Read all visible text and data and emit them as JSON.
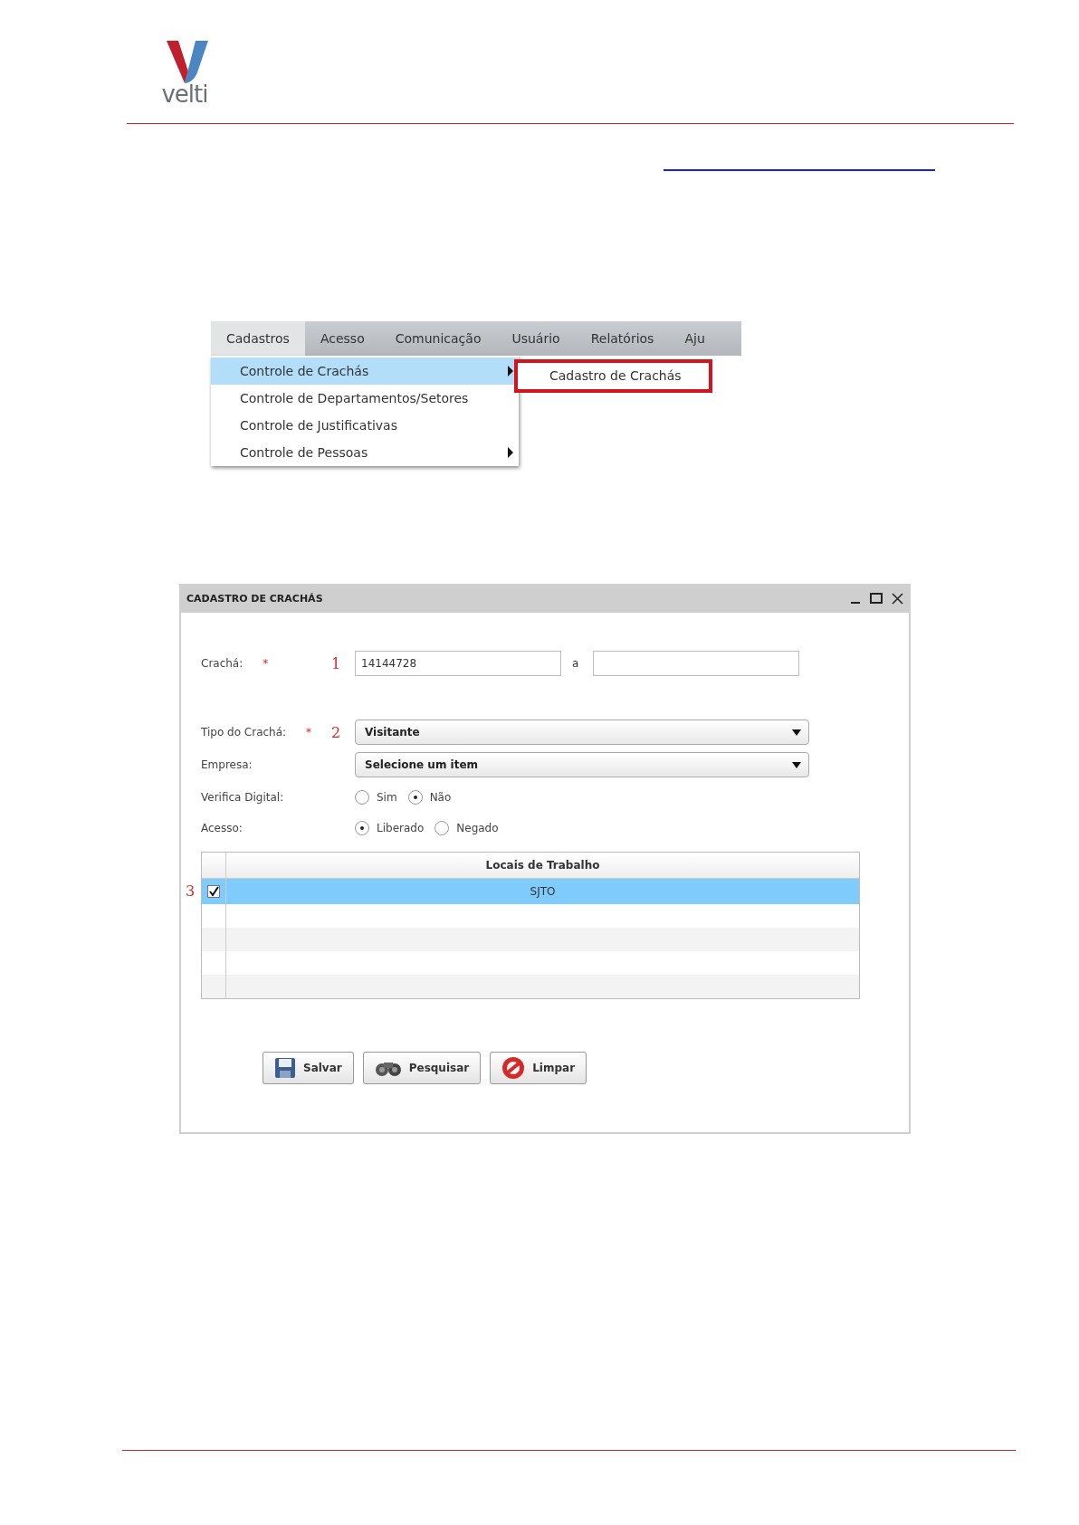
{
  "header": {
    "logo_text": "velti"
  },
  "menu_screenshot": {
    "menubar": [
      {
        "label": "Cadastros",
        "selected": true
      },
      {
        "label": "Acesso",
        "selected": false
      },
      {
        "label": "Comunicação",
        "selected": false
      },
      {
        "label": "Usuário",
        "selected": false
      },
      {
        "label": "Relatórios",
        "selected": false
      },
      {
        "label": "Aju",
        "selected": false
      }
    ],
    "dropdown": [
      {
        "label": "Controle de Crachás",
        "selected": true,
        "has_submenu": true
      },
      {
        "label": "Controle de Departamentos/Setores",
        "selected": false,
        "has_submenu": false
      },
      {
        "label": "Controle de Justificativas",
        "selected": false,
        "has_submenu": false
      },
      {
        "label": "Controle de Pessoas",
        "selected": false,
        "has_submenu": true
      }
    ],
    "submenu": [
      {
        "label": "Cadastro de Crachás",
        "highlighted": true
      }
    ]
  },
  "dialog": {
    "title": "CADASTRO DE CRACHÁS",
    "badge_field": {
      "label": "Crachá:",
      "required_mark": "*",
      "step": "1",
      "value": "14144728",
      "separator": "a"
    },
    "badge_type": {
      "label": "Tipo do Crachá:",
      "required_mark": "*",
      "step": "2",
      "value": "Visitante"
    },
    "company": {
      "label": "Empresa:",
      "value": "Selecione um item"
    },
    "radio_groups": [
      {
        "label": "Verifica Digital:",
        "options": [
          {
            "label": "Sim",
            "selected": false
          },
          {
            "label": "Não",
            "selected": true
          }
        ]
      },
      {
        "label": "Acesso:",
        "options": [
          {
            "label": "Liberado",
            "selected": true
          },
          {
            "label": "Negado",
            "selected": false
          }
        ]
      }
    ],
    "table": {
      "step": "3",
      "column": "Locais de Trabalho",
      "rows": [
        {
          "cell": "SJTO",
          "checked": true,
          "selected": true
        }
      ]
    },
    "buttons": [
      {
        "label": "Salvar",
        "kind": "save"
      },
      {
        "label": "Pesquisar",
        "kind": "search"
      },
      {
        "label": "Limpar",
        "kind": "clear"
      }
    ]
  }
}
